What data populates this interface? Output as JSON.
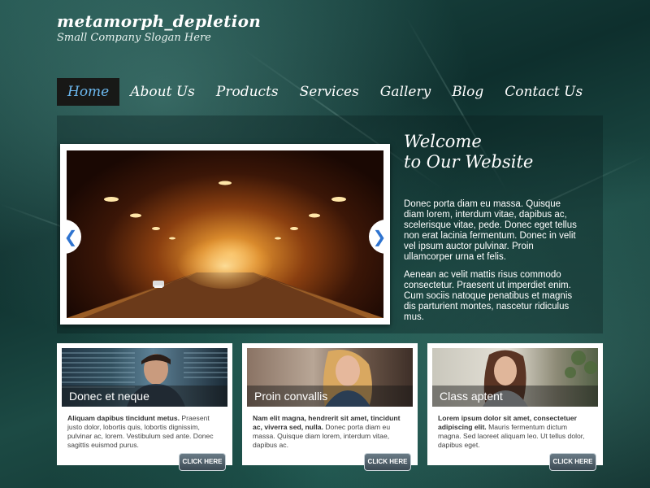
{
  "header": {
    "site_title": "metamorph_depletion",
    "slogan": "Small Company Slogan Here"
  },
  "nav": {
    "items": [
      {
        "label": "Home",
        "active": true
      },
      {
        "label": "About Us"
      },
      {
        "label": "Products"
      },
      {
        "label": "Services"
      },
      {
        "label": "Gallery"
      },
      {
        "label": "Blog"
      },
      {
        "label": "Contact Us"
      }
    ]
  },
  "slider": {
    "prev_symbol": "❮",
    "next_symbol": "❯"
  },
  "welcome": {
    "title_line1": "Welcome",
    "title_line2": "to Our Website",
    "paragraph1": "Donec porta diam eu massa. Quisque diam lorem, interdum vitae, dapibus ac, scelerisque vitae, pede. Donec eget tellus non erat lacinia fermentum. Donec in velit vel ipsum auctor pulvinar. Proin ullamcorper urna et felis.",
    "paragraph2": "Aenean ac velit mattis risus commodo consectetur. Praesent ut imperdiet enim. Cum sociis natoque penatibus et magnis dis parturient montes, nascetur ridiculus mus."
  },
  "cards": [
    {
      "caption": "Donec et neque",
      "lead": "Aliquam dapibus tincidunt metus.",
      "text": " Praesent justo dolor, lobortis quis, lobortis dignissim, pulvinar ac, lorem. Vestibulum sed ante. Donec sagittis euismod purus.",
      "button": "CLICK HERE"
    },
    {
      "caption": "Proin convallis",
      "lead": "Nam elit magna, hendrerit sit amet, tincidunt ac, viverra sed, nulla.",
      "text": " Donec porta diam eu massa. Quisque diam lorem, interdum vitae, dapibus ac.",
      "button": "CLICK HERE"
    },
    {
      "caption": "Class aptent",
      "lead": "Lorem ipsum dolor sit amet, consectetuer adipiscing elit.",
      "text": " Mauris fermentum dictum magna. Sed laoreet aliquam leo. Ut tellus dolor, dapibus eget.",
      "button": "CLICK HERE"
    }
  ],
  "colors": {
    "nav_active_text": "#6cb8ef",
    "arrow": "#2f74d0"
  }
}
